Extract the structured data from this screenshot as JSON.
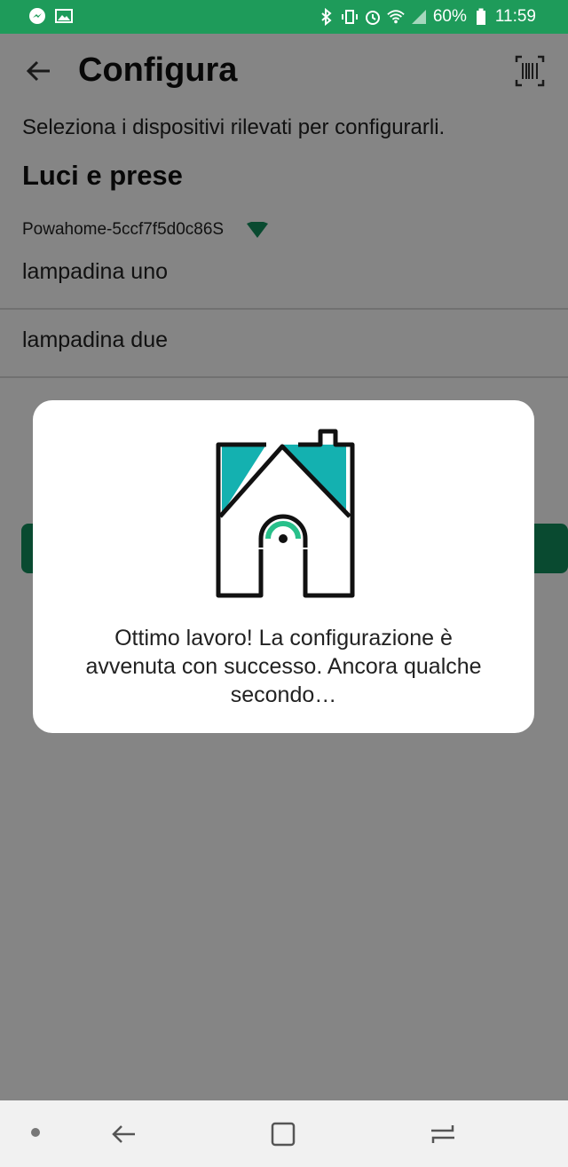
{
  "status_bar": {
    "battery": "60%",
    "time": "11:59",
    "icons_left": [
      "messenger-icon",
      "gallery-icon"
    ],
    "icons_right": [
      "bluetooth-icon",
      "vibrate-icon",
      "alarm-icon",
      "wifi-icon",
      "signal-icon",
      "battery-icon"
    ]
  },
  "header": {
    "title": "Configura"
  },
  "content": {
    "subtitle": "Seleziona i dispositivi rilevati per configurarli.",
    "section_title": "Luci e prese",
    "device_id": "Powahome-5ccf7f5d0c86S",
    "items": [
      {
        "label": "lampadina uno"
      },
      {
        "label": "lampadina due"
      }
    ]
  },
  "dialog": {
    "message": "Ottimo lavoro! La configurazione è avvenuta con successo. Ancora qualche secondo…"
  },
  "colors": {
    "status_bar": "#1e9b5a",
    "accent": "#138f5c",
    "roof": "#14b1b0",
    "house_stroke": "#111111",
    "indicator": "#28c08a"
  }
}
